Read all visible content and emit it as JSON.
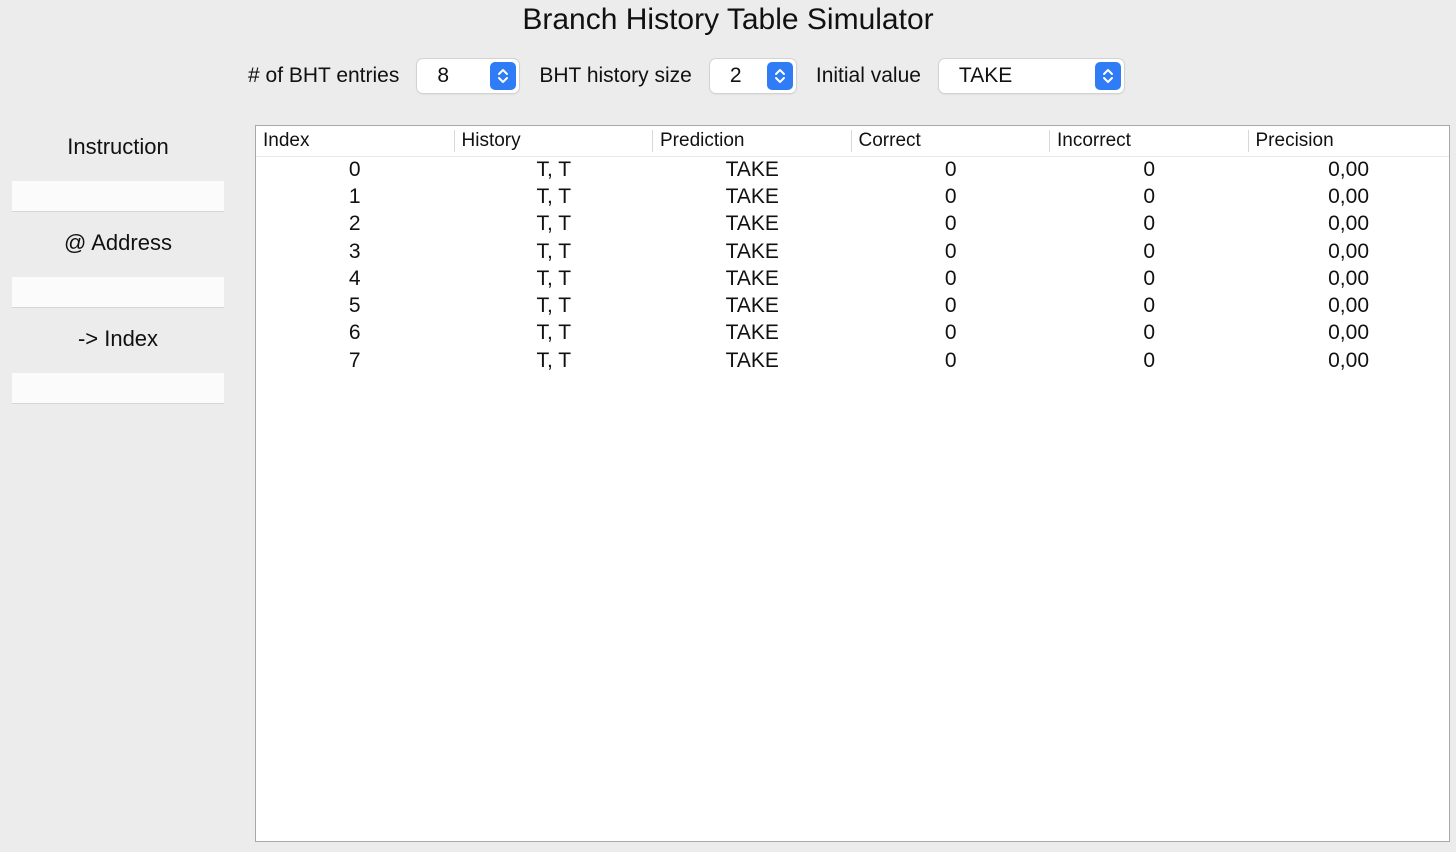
{
  "window": {
    "title": "Branch History Table Simulator"
  },
  "controls": {
    "entries_label": "# of BHT entries",
    "entries_value": "8",
    "history_label": "BHT history size",
    "history_value": "2",
    "initial_label": "Initial value",
    "initial_value": "TAKE"
  },
  "sidebar": {
    "instruction_label": "Instruction",
    "instruction_value": "",
    "address_label": "@ Address",
    "address_value": "",
    "index_label": "-> Index",
    "index_value": ""
  },
  "table": {
    "columns": [
      "Index",
      "History",
      "Prediction",
      "Correct",
      "Incorrect",
      "Precision"
    ],
    "rows": [
      [
        "0",
        "T, T",
        "TAKE",
        "0",
        "0",
        "0,00"
      ],
      [
        "1",
        "T, T",
        "TAKE",
        "0",
        "0",
        "0,00"
      ],
      [
        "2",
        "T, T",
        "TAKE",
        "0",
        "0",
        "0,00"
      ],
      [
        "3",
        "T, T",
        "TAKE",
        "0",
        "0",
        "0,00"
      ],
      [
        "4",
        "T, T",
        "TAKE",
        "0",
        "0",
        "0,00"
      ],
      [
        "5",
        "T, T",
        "TAKE",
        "0",
        "0",
        "0,00"
      ],
      [
        "6",
        "T, T",
        "TAKE",
        "0",
        "0",
        "0,00"
      ],
      [
        "7",
        "T, T",
        "TAKE",
        "0",
        "0",
        "0,00"
      ]
    ]
  },
  "colors": {
    "background": "#ececec",
    "accent": "#2f7cf6"
  },
  "icons": {
    "stepper": "up-down-chevron-icon"
  }
}
